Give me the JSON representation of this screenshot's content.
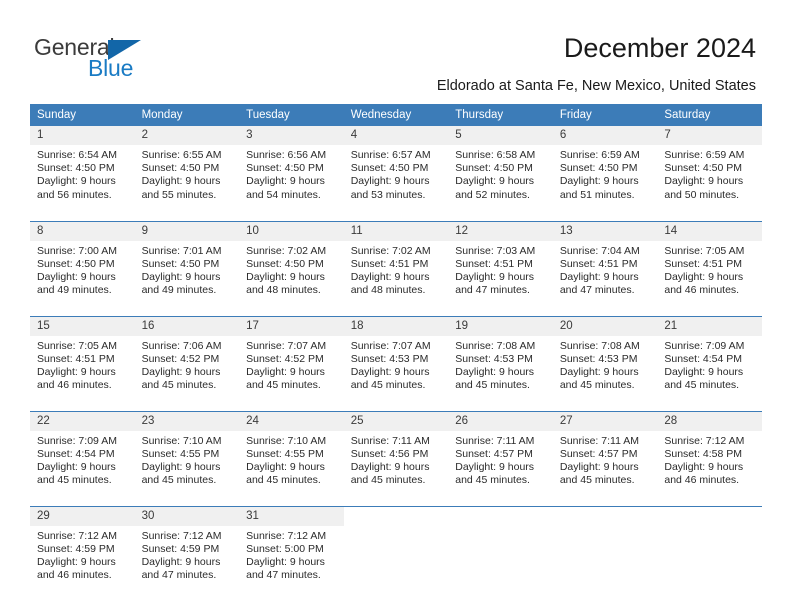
{
  "brand": {
    "name_part1": "General",
    "name_part2": "Blue",
    "accent_color": "#1a7bc4",
    "triangle_color": "#1266a8"
  },
  "header": {
    "title": "December 2024",
    "subtitle": "Eldorado at Santa Fe, New Mexico, United States",
    "header_bg_color": "#3c7cb8",
    "daynum_bg_color": "#f0f0f0"
  },
  "weekday_headers": [
    "Sunday",
    "Monday",
    "Tuesday",
    "Wednesday",
    "Thursday",
    "Friday",
    "Saturday"
  ],
  "weeks": [
    [
      {
        "day": "1",
        "sunrise": "Sunrise: 6:54 AM",
        "sunset": "Sunset: 4:50 PM",
        "daylight1": "Daylight: 9 hours",
        "daylight2": "and 56 minutes."
      },
      {
        "day": "2",
        "sunrise": "Sunrise: 6:55 AM",
        "sunset": "Sunset: 4:50 PM",
        "daylight1": "Daylight: 9 hours",
        "daylight2": "and 55 minutes."
      },
      {
        "day": "3",
        "sunrise": "Sunrise: 6:56 AM",
        "sunset": "Sunset: 4:50 PM",
        "daylight1": "Daylight: 9 hours",
        "daylight2": "and 54 minutes."
      },
      {
        "day": "4",
        "sunrise": "Sunrise: 6:57 AM",
        "sunset": "Sunset: 4:50 PM",
        "daylight1": "Daylight: 9 hours",
        "daylight2": "and 53 minutes."
      },
      {
        "day": "5",
        "sunrise": "Sunrise: 6:58 AM",
        "sunset": "Sunset: 4:50 PM",
        "daylight1": "Daylight: 9 hours",
        "daylight2": "and 52 minutes."
      },
      {
        "day": "6",
        "sunrise": "Sunrise: 6:59 AM",
        "sunset": "Sunset: 4:50 PM",
        "daylight1": "Daylight: 9 hours",
        "daylight2": "and 51 minutes."
      },
      {
        "day": "7",
        "sunrise": "Sunrise: 6:59 AM",
        "sunset": "Sunset: 4:50 PM",
        "daylight1": "Daylight: 9 hours",
        "daylight2": "and 50 minutes."
      }
    ],
    [
      {
        "day": "8",
        "sunrise": "Sunrise: 7:00 AM",
        "sunset": "Sunset: 4:50 PM",
        "daylight1": "Daylight: 9 hours",
        "daylight2": "and 49 minutes."
      },
      {
        "day": "9",
        "sunrise": "Sunrise: 7:01 AM",
        "sunset": "Sunset: 4:50 PM",
        "daylight1": "Daylight: 9 hours",
        "daylight2": "and 49 minutes."
      },
      {
        "day": "10",
        "sunrise": "Sunrise: 7:02 AM",
        "sunset": "Sunset: 4:50 PM",
        "daylight1": "Daylight: 9 hours",
        "daylight2": "and 48 minutes."
      },
      {
        "day": "11",
        "sunrise": "Sunrise: 7:02 AM",
        "sunset": "Sunset: 4:51 PM",
        "daylight1": "Daylight: 9 hours",
        "daylight2": "and 48 minutes."
      },
      {
        "day": "12",
        "sunrise": "Sunrise: 7:03 AM",
        "sunset": "Sunset: 4:51 PM",
        "daylight1": "Daylight: 9 hours",
        "daylight2": "and 47 minutes."
      },
      {
        "day": "13",
        "sunrise": "Sunrise: 7:04 AM",
        "sunset": "Sunset: 4:51 PM",
        "daylight1": "Daylight: 9 hours",
        "daylight2": "and 47 minutes."
      },
      {
        "day": "14",
        "sunrise": "Sunrise: 7:05 AM",
        "sunset": "Sunset: 4:51 PM",
        "daylight1": "Daylight: 9 hours",
        "daylight2": "and 46 minutes."
      }
    ],
    [
      {
        "day": "15",
        "sunrise": "Sunrise: 7:05 AM",
        "sunset": "Sunset: 4:51 PM",
        "daylight1": "Daylight: 9 hours",
        "daylight2": "and 46 minutes."
      },
      {
        "day": "16",
        "sunrise": "Sunrise: 7:06 AM",
        "sunset": "Sunset: 4:52 PM",
        "daylight1": "Daylight: 9 hours",
        "daylight2": "and 45 minutes."
      },
      {
        "day": "17",
        "sunrise": "Sunrise: 7:07 AM",
        "sunset": "Sunset: 4:52 PM",
        "daylight1": "Daylight: 9 hours",
        "daylight2": "and 45 minutes."
      },
      {
        "day": "18",
        "sunrise": "Sunrise: 7:07 AM",
        "sunset": "Sunset: 4:53 PM",
        "daylight1": "Daylight: 9 hours",
        "daylight2": "and 45 minutes."
      },
      {
        "day": "19",
        "sunrise": "Sunrise: 7:08 AM",
        "sunset": "Sunset: 4:53 PM",
        "daylight1": "Daylight: 9 hours",
        "daylight2": "and 45 minutes."
      },
      {
        "day": "20",
        "sunrise": "Sunrise: 7:08 AM",
        "sunset": "Sunset: 4:53 PM",
        "daylight1": "Daylight: 9 hours",
        "daylight2": "and 45 minutes."
      },
      {
        "day": "21",
        "sunrise": "Sunrise: 7:09 AM",
        "sunset": "Sunset: 4:54 PM",
        "daylight1": "Daylight: 9 hours",
        "daylight2": "and 45 minutes."
      }
    ],
    [
      {
        "day": "22",
        "sunrise": "Sunrise: 7:09 AM",
        "sunset": "Sunset: 4:54 PM",
        "daylight1": "Daylight: 9 hours",
        "daylight2": "and 45 minutes."
      },
      {
        "day": "23",
        "sunrise": "Sunrise: 7:10 AM",
        "sunset": "Sunset: 4:55 PM",
        "daylight1": "Daylight: 9 hours",
        "daylight2": "and 45 minutes."
      },
      {
        "day": "24",
        "sunrise": "Sunrise: 7:10 AM",
        "sunset": "Sunset: 4:55 PM",
        "daylight1": "Daylight: 9 hours",
        "daylight2": "and 45 minutes."
      },
      {
        "day": "25",
        "sunrise": "Sunrise: 7:11 AM",
        "sunset": "Sunset: 4:56 PM",
        "daylight1": "Daylight: 9 hours",
        "daylight2": "and 45 minutes."
      },
      {
        "day": "26",
        "sunrise": "Sunrise: 7:11 AM",
        "sunset": "Sunset: 4:57 PM",
        "daylight1": "Daylight: 9 hours",
        "daylight2": "and 45 minutes."
      },
      {
        "day": "27",
        "sunrise": "Sunrise: 7:11 AM",
        "sunset": "Sunset: 4:57 PM",
        "daylight1": "Daylight: 9 hours",
        "daylight2": "and 45 minutes."
      },
      {
        "day": "28",
        "sunrise": "Sunrise: 7:12 AM",
        "sunset": "Sunset: 4:58 PM",
        "daylight1": "Daylight: 9 hours",
        "daylight2": "and 46 minutes."
      }
    ],
    [
      {
        "day": "29",
        "sunrise": "Sunrise: 7:12 AM",
        "sunset": "Sunset: 4:59 PM",
        "daylight1": "Daylight: 9 hours",
        "daylight2": "and 46 minutes."
      },
      {
        "day": "30",
        "sunrise": "Sunrise: 7:12 AM",
        "sunset": "Sunset: 4:59 PM",
        "daylight1": "Daylight: 9 hours",
        "daylight2": "and 47 minutes."
      },
      {
        "day": "31",
        "sunrise": "Sunrise: 7:12 AM",
        "sunset": "Sunset: 5:00 PM",
        "daylight1": "Daylight: 9 hours",
        "daylight2": "and 47 minutes."
      },
      {
        "day": "",
        "sunrise": "",
        "sunset": "",
        "daylight1": "",
        "daylight2": ""
      },
      {
        "day": "",
        "sunrise": "",
        "sunset": "",
        "daylight1": "",
        "daylight2": ""
      },
      {
        "day": "",
        "sunrise": "",
        "sunset": "",
        "daylight1": "",
        "daylight2": ""
      },
      {
        "day": "",
        "sunrise": "",
        "sunset": "",
        "daylight1": "",
        "daylight2": ""
      }
    ]
  ]
}
